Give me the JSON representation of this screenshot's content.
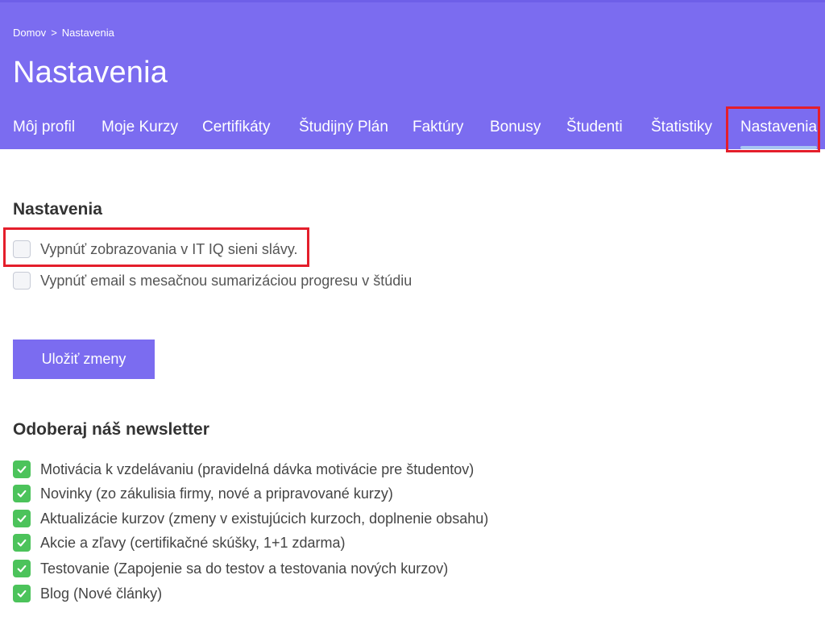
{
  "breadcrumb": {
    "home": "Domov",
    "separator": ">",
    "current": "Nastavenia"
  },
  "page_title": "Nastavenia",
  "tabs": [
    {
      "label": "Môj profil"
    },
    {
      "label": "Moje Kurzy"
    },
    {
      "label": "Certifikáty"
    },
    {
      "label": "Študijný Plán"
    },
    {
      "label": "Faktúry"
    },
    {
      "label": "Bonusy"
    },
    {
      "label": "Študenti"
    },
    {
      "label": "Štatistiky"
    },
    {
      "label": "Nastavenia",
      "active": true
    }
  ],
  "settings": {
    "title": "Nastavenia",
    "options": [
      {
        "label": "Vypnúť zobrazovania v IT IQ sieni slávy.",
        "checked": false
      },
      {
        "label": "Vypnúť email s mesačnou sumarizáciou progresu v štúdiu",
        "checked": false
      }
    ],
    "save_label": "Uložiť zmeny"
  },
  "newsletter": {
    "title": "Odoberaj náš newsletter",
    "items": [
      {
        "label": "Motivácia k vzdelávaniu (pravidelná dávka motivácie pre študentov)",
        "checked": true
      },
      {
        "label": "Novinky (zo zákulisia firmy, nové a pripravované kurzy)",
        "checked": true
      },
      {
        "label": "Aktualizácie kurzov (zmeny v existujúcich kurzoch, doplnenie obsahu)",
        "checked": true
      },
      {
        "label": "Akcie a zľavy (certifikačné skúšky, 1+1 zdarma)",
        "checked": true
      },
      {
        "label": "Testovanie (Zapojenie sa do testov a testovania nových kurzov)",
        "checked": true
      },
      {
        "label": "Blog (Nové články)",
        "checked": true
      }
    ]
  },
  "colors": {
    "brand": "#7b6cf0",
    "highlight": "#e41e2b",
    "check": "#4cc35b",
    "tab_underline": "#a7c4f2"
  }
}
